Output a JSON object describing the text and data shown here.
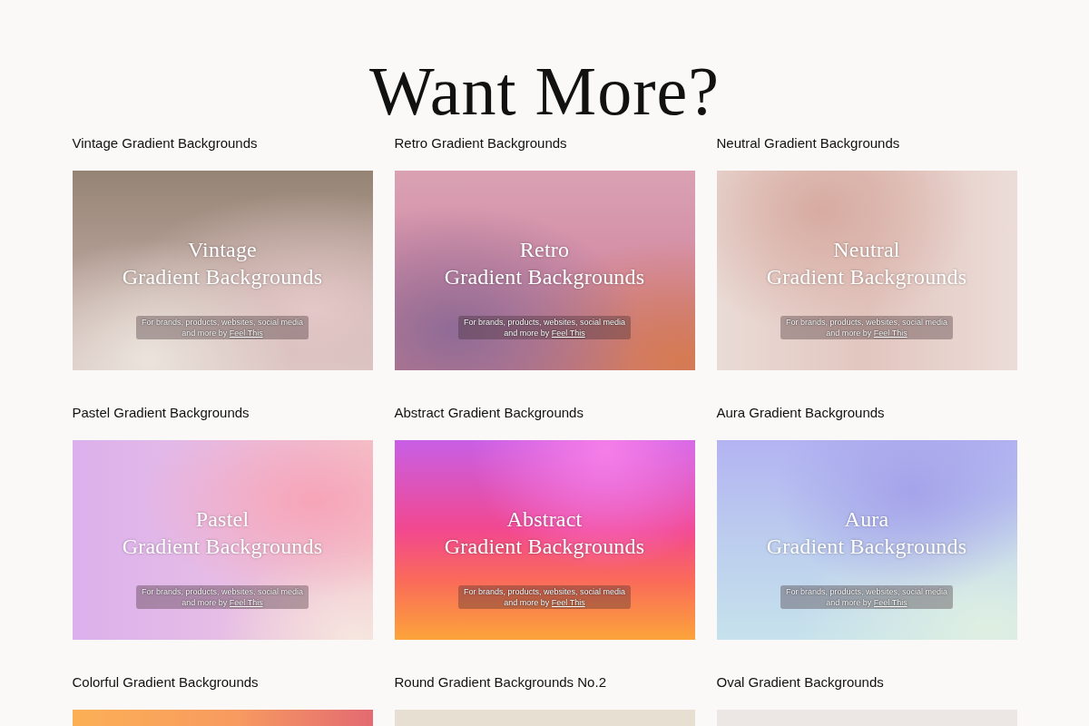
{
  "title": "Want More?",
  "products": [
    {
      "label": "Vintage Gradient Backgrounds",
      "kind": "vintage",
      "heading": [
        "Vintage",
        "Gradient Backgrounds"
      ],
      "note": "For brands, products, websites, social media",
      "note_lead": "and more by",
      "note_link": "Feel This"
    },
    {
      "label": "Retro Gradient Backgrounds",
      "kind": "retro",
      "heading": [
        "Retro",
        "Gradient Backgrounds"
      ],
      "note": "For brands, products, websites, social media",
      "note_lead": "and more by",
      "note_link": "Feel This"
    },
    {
      "label": "Neutral Gradient Backgrounds",
      "kind": "neutral",
      "heading": [
        "Neutral",
        "Gradient Backgrounds"
      ],
      "note": "For brands, products, websites, social media",
      "note_lead": "and more by",
      "note_link": "Feel This"
    },
    {
      "label": "Pastel Gradient Backgrounds",
      "kind": "pastel",
      "heading": [
        "Pastel",
        "Gradient Backgrounds"
      ],
      "note": "For brands, products, websites, social media",
      "note_lead": "and more by",
      "note_link": "Feel This"
    },
    {
      "label": "Abstract Gradient Backgrounds",
      "kind": "abstract",
      "heading": [
        "Abstract",
        "Gradient Backgrounds"
      ],
      "note": "For brands, products, websites, social media",
      "note_lead": "and more by",
      "note_link": "Feel This"
    },
    {
      "label": "Aura Gradient Backgrounds",
      "kind": "aura",
      "heading": [
        "Aura",
        "Gradient Backgrounds"
      ],
      "note": "For brands, products, websites, social media",
      "note_lead": "and more by",
      "note_link": "Feel This"
    },
    {
      "label": "Colorful Gradient Backgrounds",
      "kind": "colorful"
    },
    {
      "label": "Round Gradient Backgrounds No.2",
      "kind": "round"
    },
    {
      "label": "Oval Gradient Backgrounds",
      "kind": "oval"
    }
  ]
}
